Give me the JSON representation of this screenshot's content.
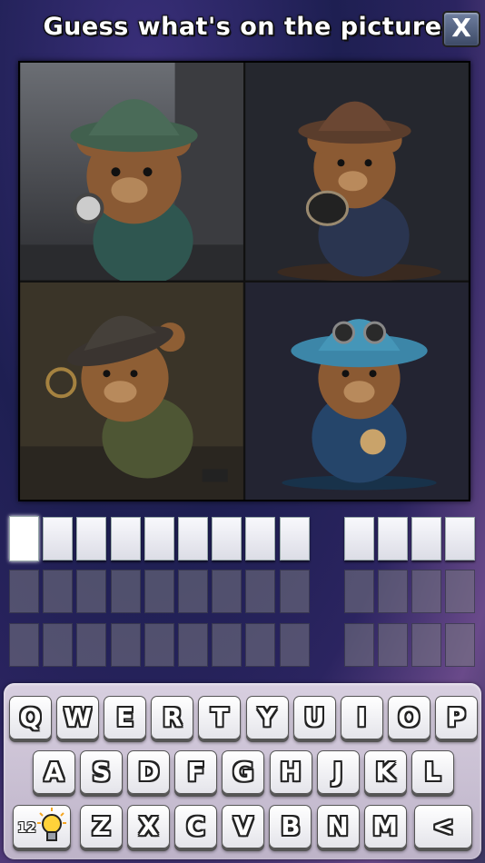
{
  "header": {
    "title": "Guess what's on the picture",
    "close_label": "X"
  },
  "pictures": [
    {
      "name": "bear-detective-green-coat",
      "hat": "#41604e",
      "coat": "#2f5650",
      "bg": "#4a4c52"
    },
    {
      "name": "bear-detective-brown-hat-camera",
      "hat": "#5a3d2c",
      "coat": "#2a3550",
      "bg": "#25272e"
    },
    {
      "name": "bear-detective-magnifier",
      "hat": "#3a3430",
      "coat": "#4e5634",
      "bg": "#3a3428"
    },
    {
      "name": "bear-detective-blue-hat-goggles",
      "hat": "#3c86a8",
      "coat": "#25456a",
      "bg": "#232432"
    }
  ],
  "answer": {
    "word_lengths": [
      9,
      4
    ],
    "letters": [
      "",
      "",
      "",
      "",
      "",
      "",
      "",
      "",
      "",
      "",
      "",
      "",
      ""
    ],
    "active_index": 0
  },
  "empty_rows": 2,
  "keyboard": {
    "row1": [
      "Q",
      "W",
      "E",
      "R",
      "T",
      "Y",
      "U",
      "I",
      "O",
      "P"
    ],
    "row2": [
      "A",
      "S",
      "D",
      "F",
      "G",
      "H",
      "J",
      "K",
      "L"
    ],
    "row3": [
      "Z",
      "X",
      "C",
      "V",
      "B",
      "N",
      "M"
    ],
    "hint_count": "12",
    "hint_icon": "lightbulb-icon",
    "backspace_label": "<"
  }
}
